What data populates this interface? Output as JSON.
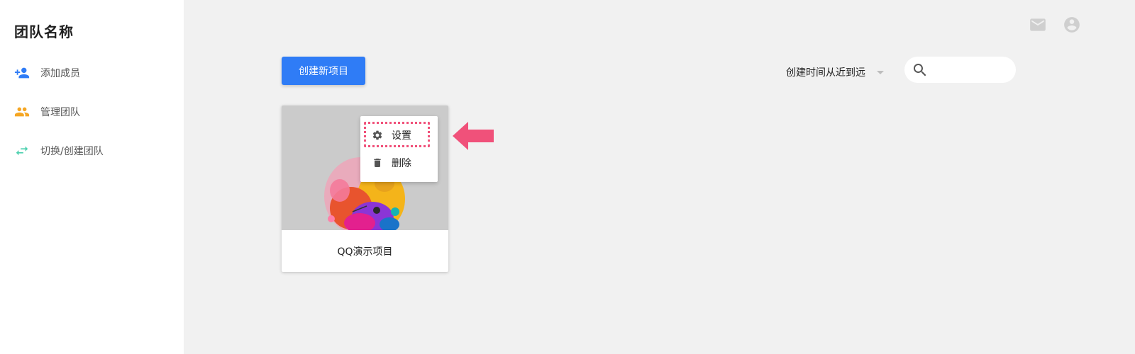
{
  "sidebar": {
    "team_name": "团队名称",
    "items": [
      {
        "label": "添加成员",
        "icon": "add-person-icon",
        "color": "#2f7cf6"
      },
      {
        "label": "管理团队",
        "icon": "group-icon",
        "color": "#f5a623"
      },
      {
        "label": "切换/创建团队",
        "icon": "swap-icon",
        "color": "#4fd1b0"
      }
    ]
  },
  "header": {
    "icons": [
      "mail-icon",
      "account-circle-icon"
    ]
  },
  "toolbar": {
    "create_label": "创建新项目",
    "sort_value": "创建时间从近到远",
    "search_placeholder": ""
  },
  "project": {
    "title": "QQ演示项目"
  },
  "context_menu": {
    "items": [
      {
        "label": "设置",
        "icon": "gear-icon"
      },
      {
        "label": "删除",
        "icon": "trash-icon"
      }
    ],
    "highlight_color": "#f0517a"
  },
  "colors": {
    "primary": "#2f7cf6",
    "annotation": "#f0517a"
  }
}
